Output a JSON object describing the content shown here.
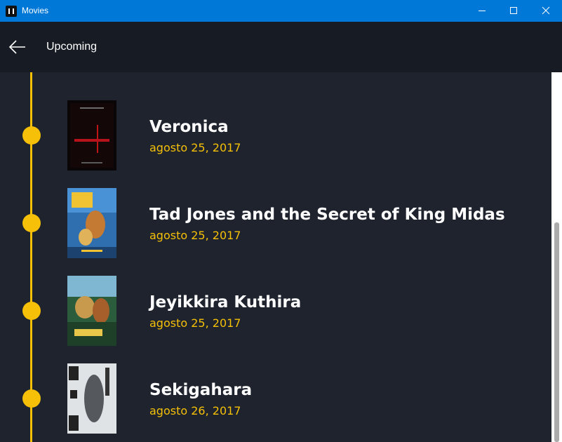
{
  "window": {
    "title": "Movies"
  },
  "header": {
    "title": "Upcoming"
  },
  "movies": [
    {
      "title": "Veronica",
      "date": "agosto 25, 2017"
    },
    {
      "title": "Tad Jones and the Secret of King Midas",
      "date": "agosto 25, 2017"
    },
    {
      "title": "Jeyikkira Kuthira",
      "date": "agosto 25, 2017"
    },
    {
      "title": "Sekigahara",
      "date": "agosto 26, 2017"
    }
  ],
  "colors": {
    "accent": "#f5c007",
    "background": "#1e232e",
    "header": "#171b24",
    "titlebar": "#0078d7"
  },
  "icons": {
    "back": "back-arrow-icon",
    "minimize": "minimize-icon",
    "maximize": "maximize-icon",
    "close": "close-icon"
  }
}
